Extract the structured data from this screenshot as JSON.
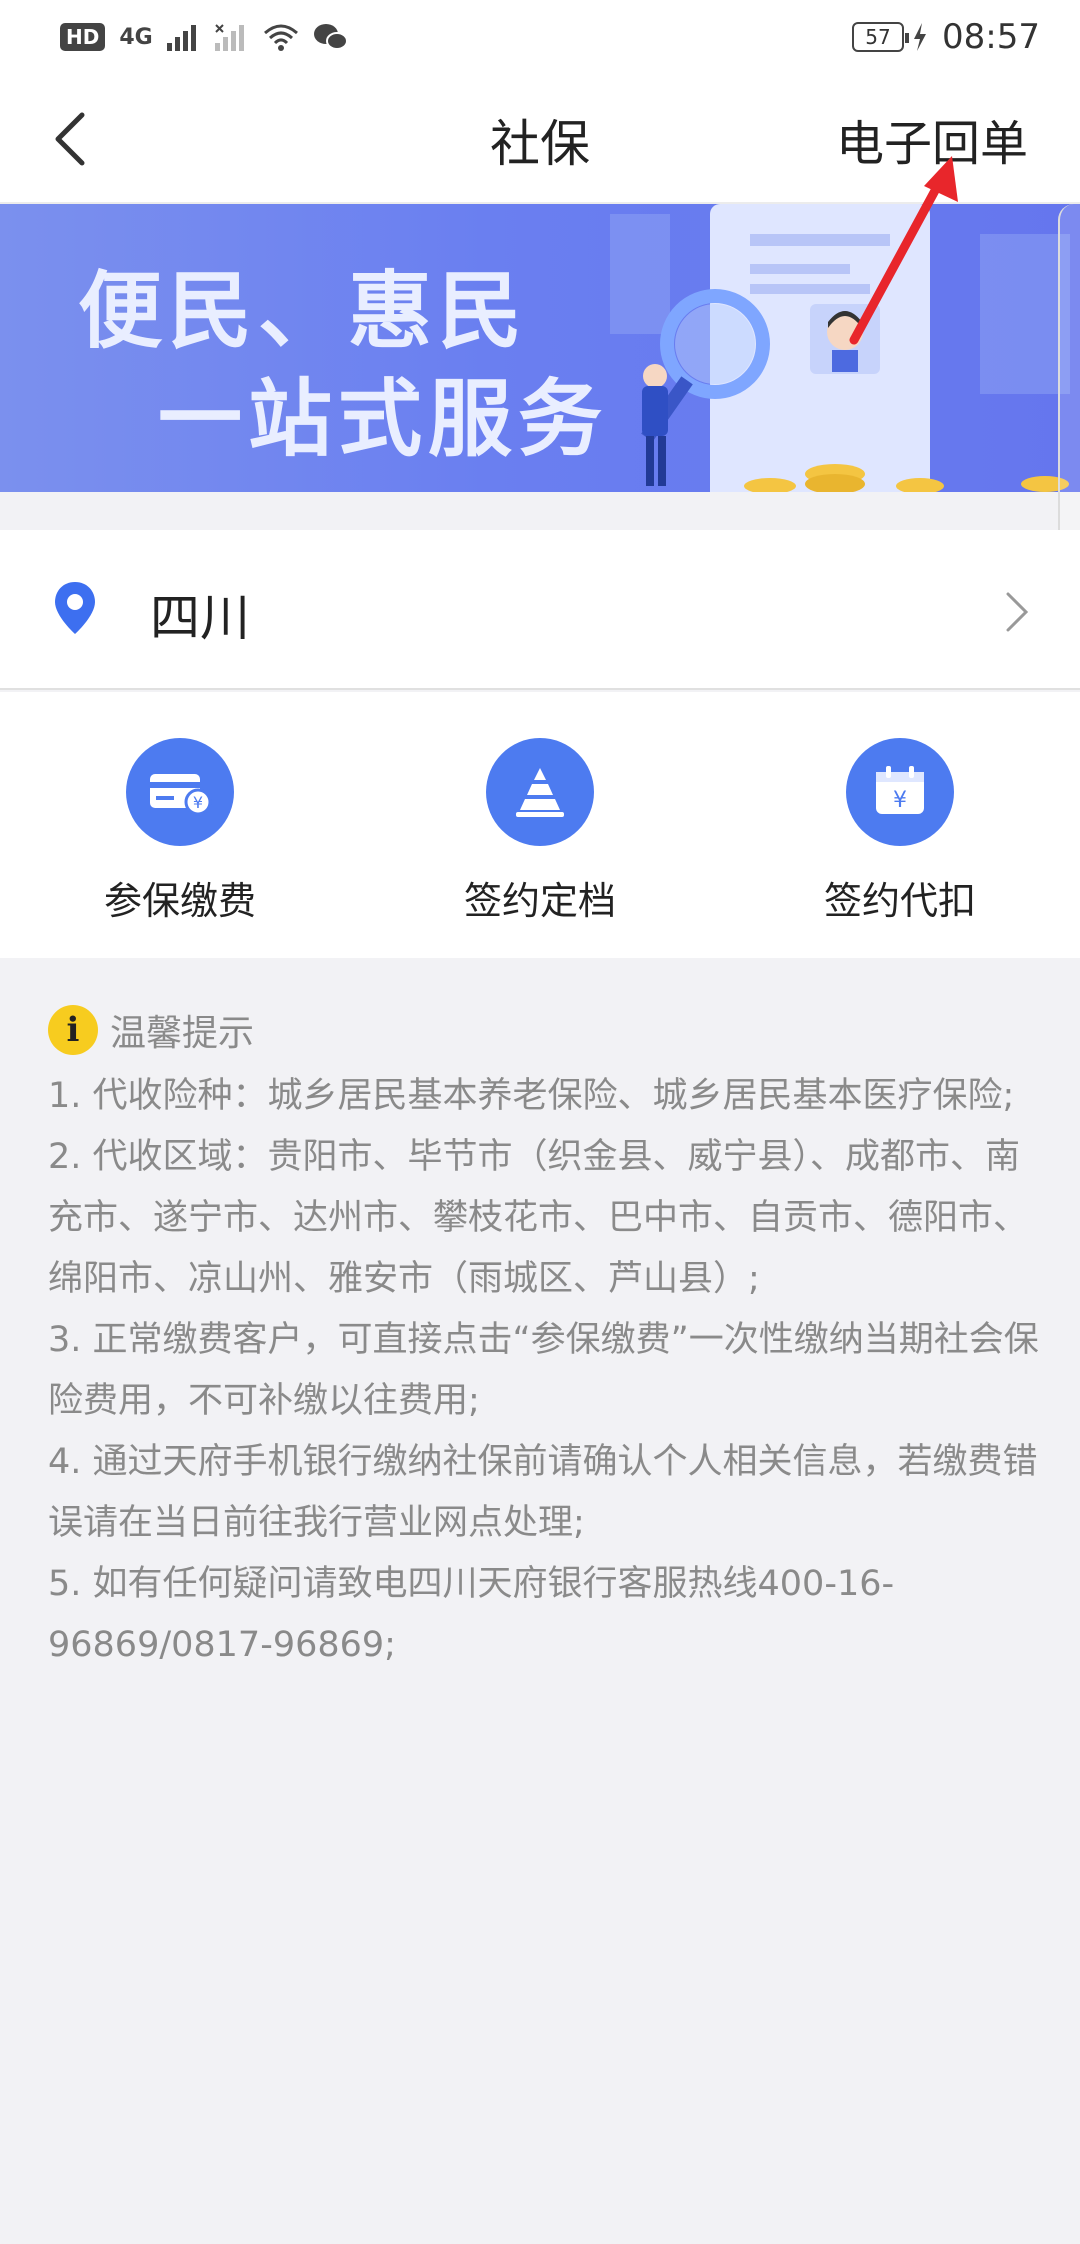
{
  "status_bar": {
    "hd": "HD",
    "network": "4G",
    "battery": "57",
    "time": "08:57"
  },
  "header": {
    "title": "社保",
    "right_link": "电子回单"
  },
  "banner": {
    "line1": "便民、惠民",
    "line2": "一站式服务"
  },
  "location": {
    "label": "四川"
  },
  "services": [
    {
      "label": "参保缴费",
      "icon": "card-payment-icon"
    },
    {
      "label": "签约定档",
      "icon": "cone-tier-icon"
    },
    {
      "label": "签约代扣",
      "icon": "calendar-yen-icon"
    }
  ],
  "tips": {
    "title": "温馨提示",
    "items": [
      "1. 代收险种：城乡居民基本养老保险、城乡居民基本医疗保险;",
      "2. 代收区域：贵阳市、毕节市（织金县、威宁县）、成都市、南充市、遂宁市、达州市、攀枝花市、巴中市、自贡市、德阳市、绵阳市、凉山州、雅安市（雨城区、芦山县）;",
      "3. 正常缴费客户，可直接点击“参保缴费”一次性缴纳当期社会保险费用，不可补缴以往费用;",
      "4. 通过天府手机银行缴纳社保前请确认个人相关信息，若缴费错误请在当日前往我行营业网点处理;",
      "5. 如有任何疑问请致电四川天府银行客服热线400-16-96869/0817-96869;"
    ]
  },
  "colors": {
    "accent_blue": "#4d7bf0",
    "banner_blue": "#6a7ff0",
    "info_yellow": "#f7cc1f",
    "annotation_red": "#e8262b"
  }
}
